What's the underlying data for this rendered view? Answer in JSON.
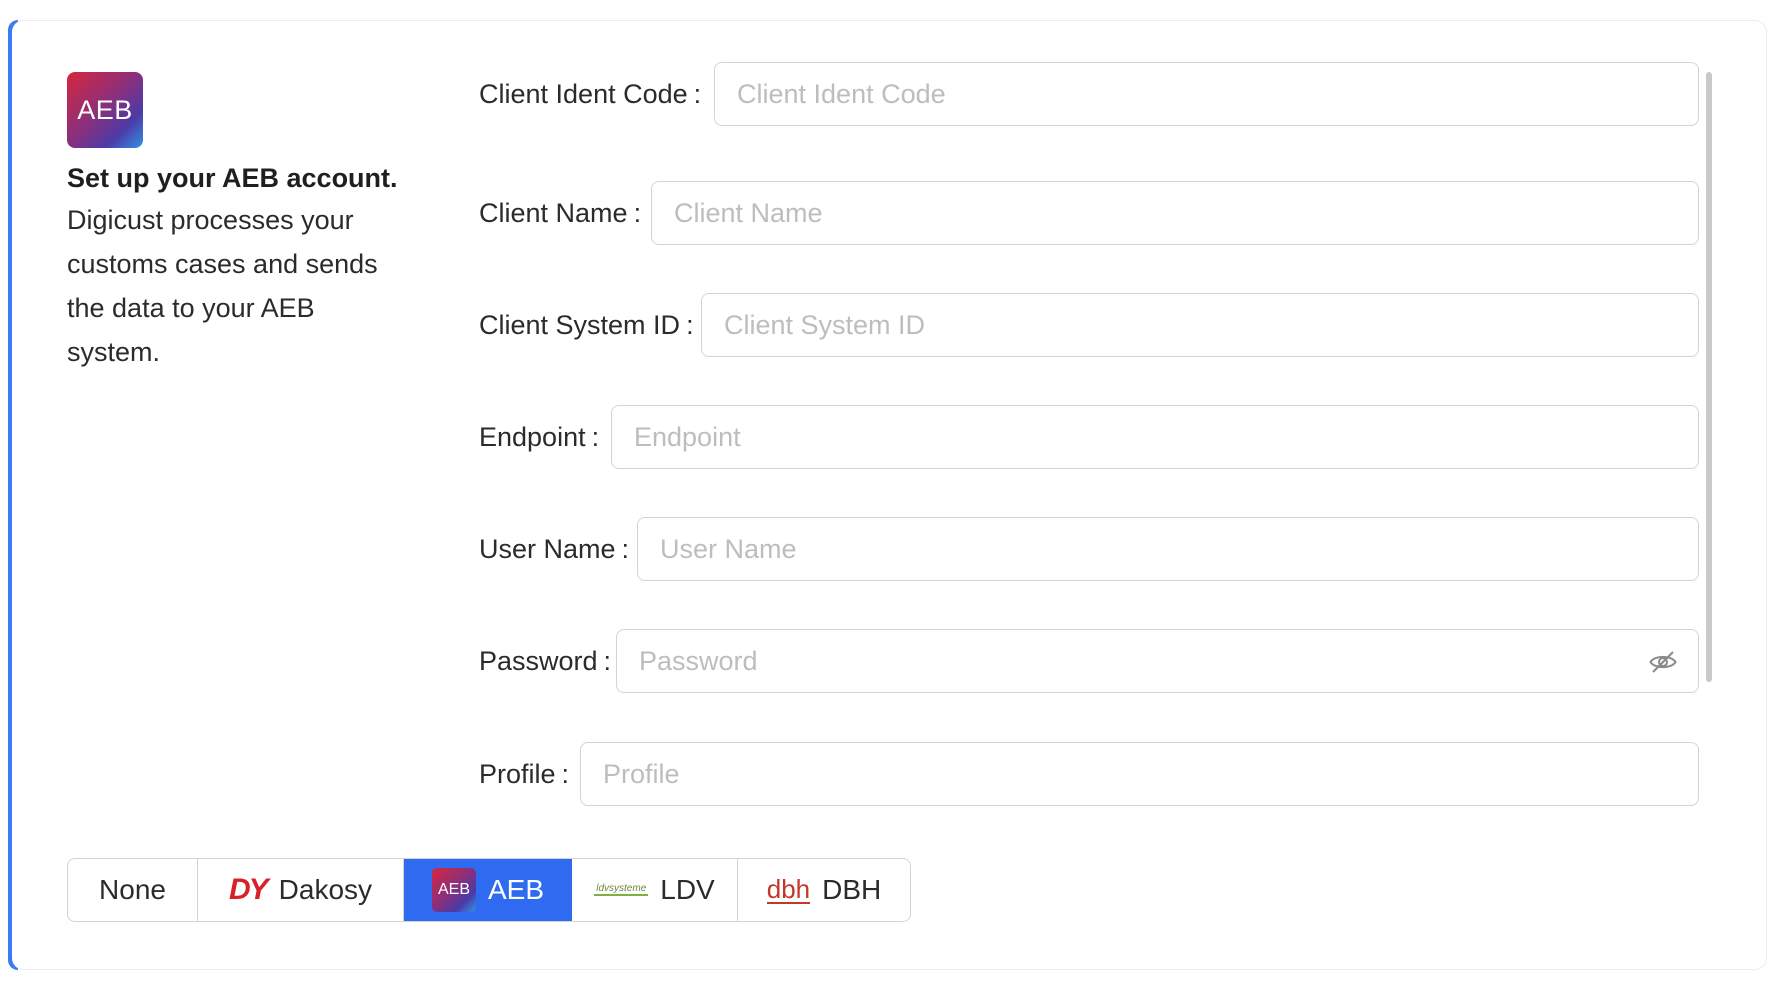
{
  "intro": {
    "logo_text": "AEB",
    "title": "Set up your AEB account.",
    "description": "Digicust processes your customs cases and sends the data to your AEB system."
  },
  "form": {
    "colon": ":",
    "fields": [
      {
        "label": "Client Ident Code",
        "placeholder": "Client Ident Code",
        "value": ""
      },
      {
        "label": "Client Name",
        "placeholder": "Client Name",
        "value": ""
      },
      {
        "label": "Client System ID",
        "placeholder": "Client System ID",
        "value": ""
      },
      {
        "label": "Endpoint",
        "placeholder": "Endpoint",
        "value": ""
      },
      {
        "label": "User Name",
        "placeholder": "User Name",
        "value": ""
      },
      {
        "label": "Password",
        "placeholder": "Password",
        "value": ""
      },
      {
        "label": "Profile",
        "placeholder": "Profile",
        "value": ""
      }
    ],
    "password_toggle_icon": "eye-off-icon"
  },
  "providers": {
    "selected": "AEB",
    "items": [
      {
        "label": "None",
        "logo_text": ""
      },
      {
        "label": "Dakosy",
        "logo_text": "DY"
      },
      {
        "label": "AEB",
        "logo_text": "AEB"
      },
      {
        "label": "LDV",
        "logo_text": "ldvsysteme"
      },
      {
        "label": "DBH",
        "logo_text": "dbh"
      }
    ]
  },
  "colors": {
    "accent": "#3b7cf5",
    "active_segment": "#2f6bf0",
    "border": "#d4d4d4",
    "placeholder": "#bdbdbd",
    "dakosy_red": "#d7202a"
  }
}
